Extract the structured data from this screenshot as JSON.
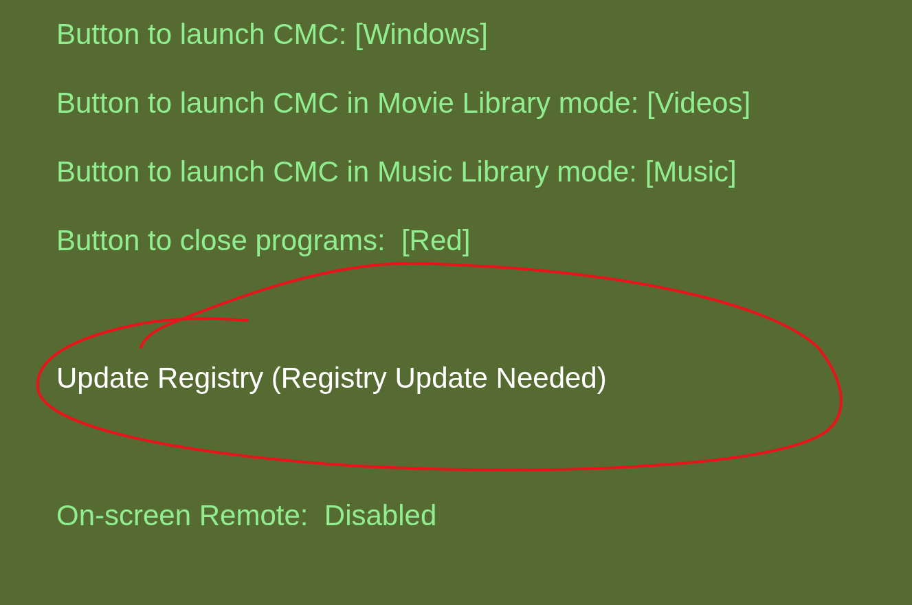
{
  "settings": [
    {
      "kind": "option",
      "label": "Button to launch CMC: [Windows]"
    },
    {
      "kind": "option",
      "label": "Button to launch CMC in Movie Library mode: [Videos]"
    },
    {
      "kind": "option",
      "label": "Button to launch CMC in Music Library mode: [Music]"
    },
    {
      "kind": "option",
      "label": "Button to close programs:  [Red]"
    },
    {
      "kind": "action",
      "label": "Update Registry (Registry Update Needed)"
    },
    {
      "kind": "option",
      "label": "On-screen Remote:  Disabled"
    }
  ]
}
